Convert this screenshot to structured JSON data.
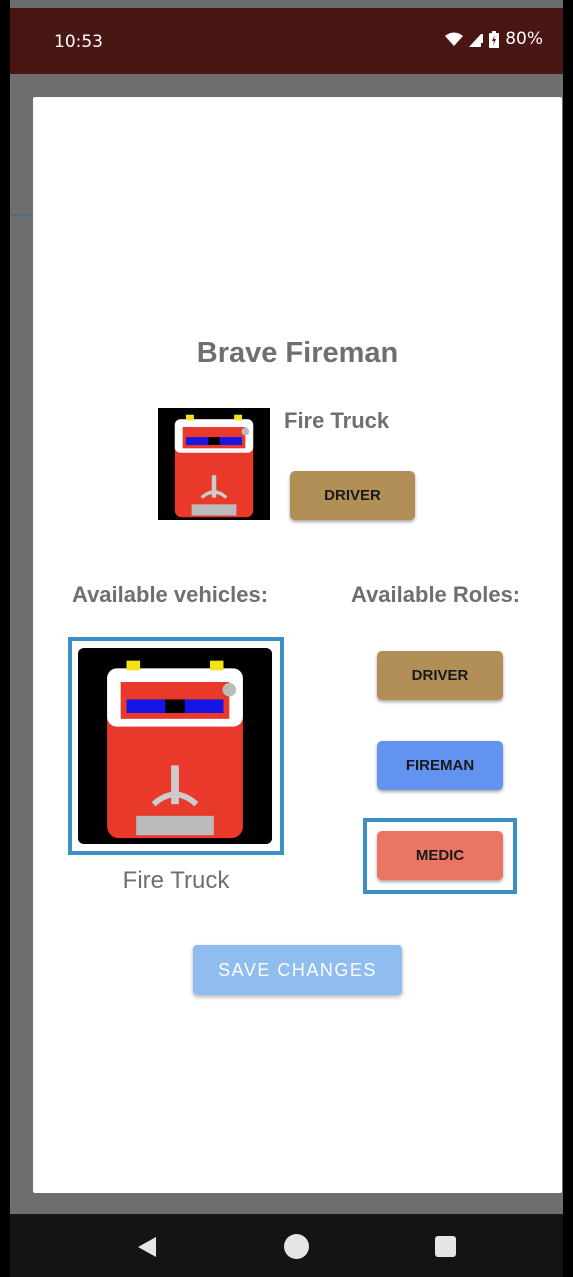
{
  "status_bar": {
    "time": "10:53",
    "battery": "80%",
    "icons": [
      "wifi-icon",
      "signal-icon",
      "battery-icon"
    ]
  },
  "dialog": {
    "title": "Brave Fireman",
    "current_vehicle": {
      "name": "Fire Truck",
      "image": "fire-truck-image"
    },
    "current_role": "DRIVER",
    "available_vehicles_label": "Available vehicles:",
    "available_roles_label": "Available Roles:",
    "vehicles": [
      {
        "name": "Fire Truck",
        "image": "fire-truck-image",
        "selected": true
      }
    ],
    "roles": [
      {
        "label": "DRIVER",
        "color": "#b18f56",
        "selected": false
      },
      {
        "label": "FIREMAN",
        "color": "#6293f0",
        "selected": false
      },
      {
        "label": "MEDIC",
        "color": "#e97562",
        "selected": true
      }
    ],
    "save_label": "SAVE CHANGES"
  },
  "colors": {
    "status_bar": "#4a1614",
    "selection_border": "#3b8fc6",
    "save_button": "#8fbdf0",
    "text_gray": "#6f6f6f"
  },
  "nav_bar": {
    "icons": [
      "back-icon",
      "home-icon",
      "recents-icon"
    ]
  }
}
